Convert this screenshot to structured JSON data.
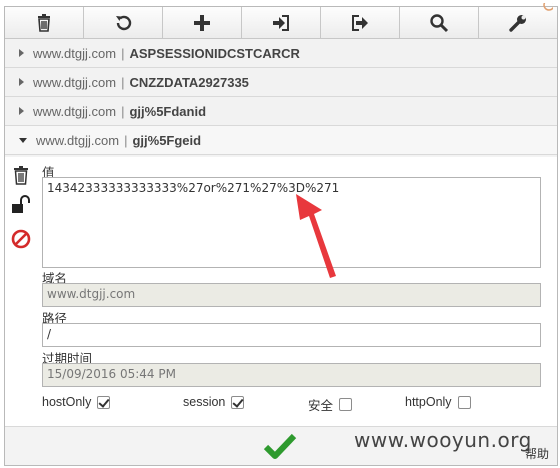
{
  "toolbar": {
    "buttons": [
      {
        "icon": "trash-icon"
      },
      {
        "icon": "refresh-icon"
      },
      {
        "icon": "plus-icon"
      },
      {
        "icon": "import-icon"
      },
      {
        "icon": "export-icon"
      },
      {
        "icon": "search-icon"
      },
      {
        "icon": "wrench-icon"
      }
    ]
  },
  "cookies": [
    {
      "domain": "www.dtgjj.com",
      "separator": "|",
      "name": "ASPSESSIONIDCSTCARCR",
      "expanded": false
    },
    {
      "domain": "www.dtgjj.com",
      "separator": "|",
      "name": "CNZZDATA2927335",
      "expanded": false
    },
    {
      "domain": "www.dtgjj.com",
      "separator": "|",
      "name": "gjj%5Fdanid",
      "expanded": false
    },
    {
      "domain": "www.dtgjj.com",
      "separator": "|",
      "name": "gjj%5Fgeid",
      "expanded": true
    }
  ],
  "details": {
    "value_label": "值",
    "value": "14342333333333333%27or%271%27%3D%271",
    "domain_label": "域名",
    "domain_value": "www.dtgjj.com",
    "path_label": "路径",
    "path_value": "/",
    "expires_label": "过期时间",
    "expires_value": "15/09/2016 05:44 PM",
    "checks": [
      {
        "label": "hostOnly",
        "checked": true
      },
      {
        "label": "session",
        "checked": true
      },
      {
        "label": "安全",
        "checked": false
      },
      {
        "label": "httpOnly",
        "checked": false
      }
    ]
  },
  "footer": {
    "help_label": "帮助"
  },
  "watermark": "www.wooyun.org",
  "colors": {
    "save_green": "#2e9a2e",
    "block_red": "#d42a2a",
    "arrow_red": "#e8383d"
  }
}
